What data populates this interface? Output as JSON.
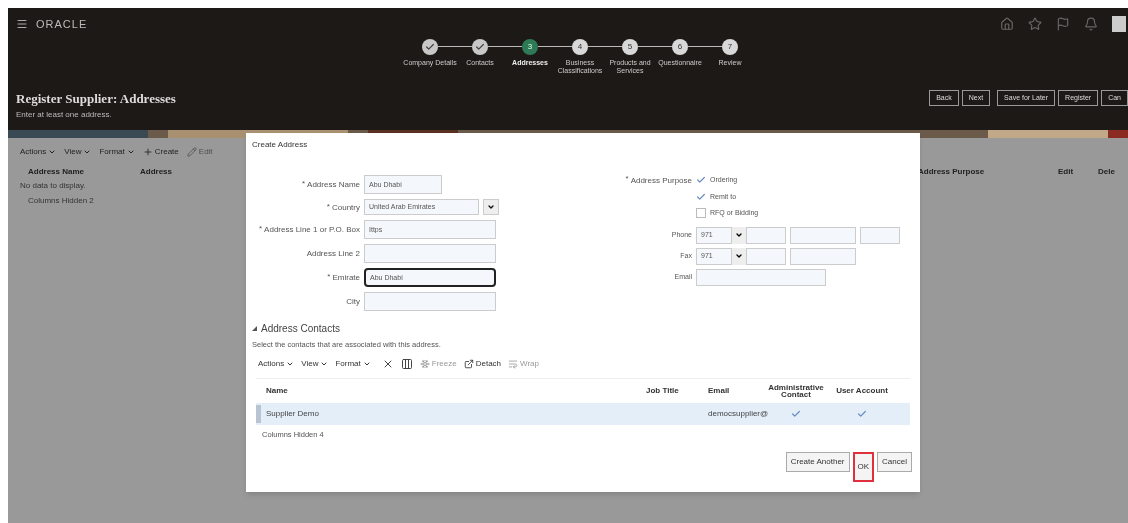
{
  "brand": "ORACLE",
  "train": [
    {
      "label": "Company Details",
      "completed": true,
      "selected": false
    },
    {
      "label": "Contacts",
      "completed": true,
      "selected": false
    },
    {
      "label": "Addresses",
      "completed": false,
      "selected": true,
      "number": "3"
    },
    {
      "label": "Business Classifications",
      "completed": false,
      "selected": false,
      "number": "4"
    },
    {
      "label": "Products and Services",
      "completed": false,
      "selected": false,
      "number": "5"
    },
    {
      "label": "Questionnaire",
      "completed": false,
      "selected": false,
      "number": "6"
    },
    {
      "label": "Review",
      "completed": false,
      "selected": false,
      "number": "7"
    }
  ],
  "page_title": "Register Supplier: Addresses",
  "page_subtitle": "Enter at least one address.",
  "header_buttons": [
    "Back",
    "Next",
    "Save for Later",
    "Register",
    "Can"
  ],
  "background_table": {
    "toolbar": [
      {
        "label": "Actions",
        "kind": "menu",
        "disabled": false
      },
      {
        "label": "View",
        "kind": "menu",
        "disabled": false
      },
      {
        "label": "Format",
        "kind": "menu",
        "disabled": false
      },
      {
        "label": "Create",
        "kind": "create",
        "disabled": false
      },
      {
        "label": "Edit",
        "kind": "edit",
        "disabled": true
      }
    ],
    "left_columns": [
      "Address Name",
      "Address"
    ],
    "right_columns": [
      "Address Purpose",
      "Edit",
      "Dele"
    ],
    "empty_text": "No data to display.",
    "columns_hidden": "Columns Hidden 2"
  },
  "dialog": {
    "title": "Create Address",
    "fields": [
      {
        "label": "Address Name",
        "kind": "text",
        "required_mark": "*",
        "value": "Abu Dhabi",
        "focused": false
      },
      {
        "label": "Country",
        "kind": "select",
        "required_mark": "*",
        "value": "United Arab Emirates",
        "focused": false
      },
      {
        "label": "Address Line 1 or P.O. Box",
        "kind": "text",
        "required_mark": "*",
        "value": "Ittps",
        "focused": false
      },
      {
        "label": "Address Line 2",
        "kind": "text",
        "focused": false
      },
      {
        "label": "Emirate",
        "kind": "text",
        "required_mark": "*",
        "value": "Abu Dhabi",
        "focused": true
      },
      {
        "label": "City",
        "kind": "text",
        "focused": false
      }
    ],
    "purpose_label": "Address Purpose",
    "purpose_required_mark": "*",
    "purposes": [
      {
        "label": "Ordering",
        "checked": true
      },
      {
        "label": "Remit to",
        "checked": true
      },
      {
        "label": "RFQ or Bidding",
        "checked": false
      }
    ],
    "phone": {
      "label": "Phone",
      "code": "971"
    },
    "fax": {
      "label": "Fax",
      "code": "971"
    },
    "email": {
      "label": "Email"
    },
    "contacts": {
      "title": "Address Contacts",
      "expanded": true,
      "description": "Select the contacts that are associated with this address.",
      "toolbar": [
        {
          "label": "Actions",
          "kind": "menu",
          "disabled": false
        },
        {
          "label": "View",
          "kind": "menu",
          "disabled": false
        },
        {
          "label": "Format",
          "kind": "menu",
          "disabled": false
        },
        {
          "label": "Freeze",
          "kind": "freeze",
          "disabled": true
        },
        {
          "label": "Detach",
          "kind": "detach",
          "disabled": false
        },
        {
          "label": "Wrap",
          "kind": "wrap",
          "disabled": true
        }
      ],
      "columns": [
        "Name",
        "Job Title",
        "Email",
        "Administrative Contact",
        "User Account"
      ],
      "rows": [
        {
          "name": "Supplier Demo",
          "email": "democsupplier@",
          "admin": true,
          "user_account": true,
          "selected": true
        }
      ],
      "columns_hidden": "Columns Hidden 4"
    },
    "buttons": [
      {
        "label": "Create Another",
        "highlighted": false
      },
      {
        "label": "OK",
        "highlighted": true
      },
      {
        "label": "Cancel",
        "highlighted": false
      }
    ]
  }
}
